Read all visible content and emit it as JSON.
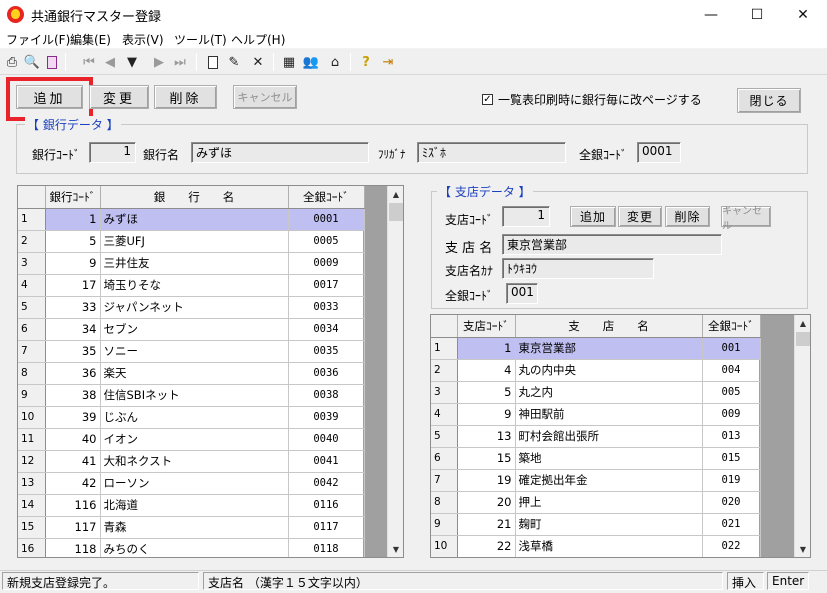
{
  "window": {
    "title": "共通銀行マスター登録",
    "minimize": "—",
    "maximize": "☐",
    "close": "✕"
  },
  "menu": [
    "ファイル(F)",
    "編集(E)",
    "表示(V)",
    "ツール(T)",
    "ヘルプ(H)"
  ],
  "toolbar": {
    "icons": [
      "print-icon",
      "print-preview-icon",
      "page-setup-icon",
      "first-record-icon",
      "prev-record-icon",
      "dropdown-icon",
      "next-record-icon",
      "last-record-icon",
      "new-document-icon",
      "edit-icon",
      "delete-icon",
      "calculator-icon",
      "users-icon",
      "home-icon",
      "help-icon",
      "exit-icon"
    ]
  },
  "actions": {
    "add": "追加",
    "change": "変更",
    "delete": "削除",
    "cancel": "キャンセル",
    "close": "閉じる"
  },
  "option": {
    "label": "一覧表印刷時に銀行毎に改ページする",
    "checked": true,
    "mark": "✓"
  },
  "bank": {
    "group_label": "【 銀行データ 】",
    "code_label": "銀行ｺｰﾄﾞ",
    "code": "1",
    "name_label": "銀行名",
    "name": "みずほ",
    "kana_label": "ﾌﾘｶﾞﾅ",
    "kana": "ﾐｽﾞﾎ",
    "zengin_label": "全銀ｺｰﾄﾞ",
    "zengin": "0001"
  },
  "bank_grid": {
    "headers": [
      "銀行ｺｰﾄﾞ",
      "銀　　行　　名",
      "全銀ｺｰﾄﾞ"
    ],
    "rows": [
      {
        "n": "1",
        "code": "1",
        "name": "みずほ",
        "zengin": "0001"
      },
      {
        "n": "2",
        "code": "5",
        "name": "三菱UFJ",
        "zengin": "0005"
      },
      {
        "n": "3",
        "code": "9",
        "name": "三井住友",
        "zengin": "0009"
      },
      {
        "n": "4",
        "code": "17",
        "name": "埼玉りそな",
        "zengin": "0017"
      },
      {
        "n": "5",
        "code": "33",
        "name": "ジャパンネット",
        "zengin": "0033"
      },
      {
        "n": "6",
        "code": "34",
        "name": "セブン",
        "zengin": "0034"
      },
      {
        "n": "7",
        "code": "35",
        "name": "ソニー",
        "zengin": "0035"
      },
      {
        "n": "8",
        "code": "36",
        "name": "楽天",
        "zengin": "0036"
      },
      {
        "n": "9",
        "code": "38",
        "name": "住信SBIネット",
        "zengin": "0038"
      },
      {
        "n": "10",
        "code": "39",
        "name": "じぶん",
        "zengin": "0039"
      },
      {
        "n": "11",
        "code": "40",
        "name": "イオン",
        "zengin": "0040"
      },
      {
        "n": "12",
        "code": "41",
        "name": "大和ネクスト",
        "zengin": "0041"
      },
      {
        "n": "13",
        "code": "42",
        "name": "ローソン",
        "zengin": "0042"
      },
      {
        "n": "14",
        "code": "116",
        "name": "北海道",
        "zengin": "0116"
      },
      {
        "n": "15",
        "code": "117",
        "name": "青森",
        "zengin": "0117"
      },
      {
        "n": "16",
        "code": "118",
        "name": "みちのく",
        "zengin": "0118"
      }
    ]
  },
  "branch": {
    "group_label": "【 支店データ 】",
    "code_label": "支店ｺｰﾄﾞ",
    "code": "1",
    "name_label": "支 店 名",
    "name": "東京営業部",
    "kana_label": "支店名ｶﾅ",
    "kana": "ﾄｳｷﾖｳ",
    "zengin_label": "全銀ｺｰﾄﾞ",
    "zengin": "001"
  },
  "branch_grid": {
    "headers": [
      "支店ｺｰﾄﾞ",
      "支　　店　　名",
      "全銀ｺｰﾄﾞ"
    ],
    "rows": [
      {
        "n": "1",
        "code": "1",
        "name": "東京営業部",
        "zengin": "001"
      },
      {
        "n": "2",
        "code": "4",
        "name": "丸の内中央",
        "zengin": "004"
      },
      {
        "n": "3",
        "code": "5",
        "name": "丸之内",
        "zengin": "005"
      },
      {
        "n": "4",
        "code": "9",
        "name": "神田駅前",
        "zengin": "009"
      },
      {
        "n": "5",
        "code": "13",
        "name": "町村会館出張所",
        "zengin": "013"
      },
      {
        "n": "6",
        "code": "15",
        "name": "築地",
        "zengin": "015"
      },
      {
        "n": "7",
        "code": "19",
        "name": "確定拠出年金",
        "zengin": "019"
      },
      {
        "n": "8",
        "code": "20",
        "name": "押上",
        "zengin": "020"
      },
      {
        "n": "9",
        "code": "21",
        "name": "麹町",
        "zengin": "021"
      },
      {
        "n": "10",
        "code": "22",
        "name": "浅草橋",
        "zengin": "022"
      }
    ]
  },
  "status": {
    "message": "新規支店登録完了。",
    "hint": "支店名 （漢字１５文字以内）",
    "mode": "挿入",
    "key": "Enter"
  },
  "colors": {
    "selected_row": "#bfbff2",
    "group_label": "#1a3fbf",
    "highlight_frame": "#e8232a"
  }
}
